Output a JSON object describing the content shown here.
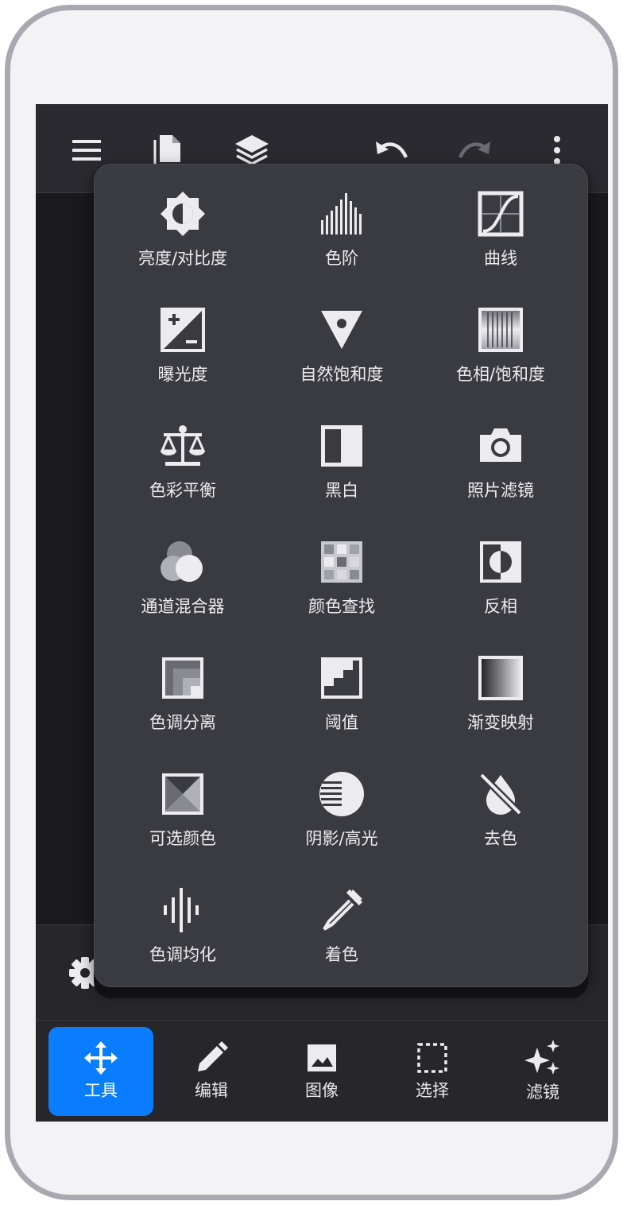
{
  "top_bar": {
    "icons": [
      "menu-icon",
      "documents-icon",
      "layers-icon",
      "undo-icon",
      "redo-icon",
      "more-vertical-icon"
    ]
  },
  "adjustments_menu": {
    "items": [
      {
        "label": "亮度/对比度",
        "icon": "brightness-contrast-icon"
      },
      {
        "label": "色阶",
        "icon": "levels-icon"
      },
      {
        "label": "曲线",
        "icon": "curves-icon"
      },
      {
        "label": "曝光度",
        "icon": "exposure-icon"
      },
      {
        "label": "自然饱和度",
        "icon": "vibrance-icon"
      },
      {
        "label": "色相/饱和度",
        "icon": "hue-saturation-icon"
      },
      {
        "label": "色彩平衡",
        "icon": "color-balance-icon"
      },
      {
        "label": "黑白",
        "icon": "black-white-icon"
      },
      {
        "label": "照片滤镜",
        "icon": "photo-filter-icon"
      },
      {
        "label": "通道混合器",
        "icon": "channel-mixer-icon"
      },
      {
        "label": "颜色查找",
        "icon": "color-lookup-icon"
      },
      {
        "label": "反相",
        "icon": "invert-icon"
      },
      {
        "label": "色调分离",
        "icon": "posterize-icon"
      },
      {
        "label": "阈值",
        "icon": "threshold-icon"
      },
      {
        "label": "渐变映射",
        "icon": "gradient-map-icon"
      },
      {
        "label": "可选颜色",
        "icon": "selective-color-icon"
      },
      {
        "label": "阴影/高光",
        "icon": "shadows-highlights-icon"
      },
      {
        "label": "去色",
        "icon": "desaturate-icon"
      },
      {
        "label": "色调均化",
        "icon": "equalize-icon"
      },
      {
        "label": "着色",
        "icon": "colorize-icon"
      }
    ]
  },
  "bottom_nav": {
    "items": [
      {
        "label": "工具",
        "icon": "move-icon",
        "active": true
      },
      {
        "label": "编辑",
        "icon": "pencil-icon",
        "active": false
      },
      {
        "label": "图像",
        "icon": "image-icon",
        "active": false
      },
      {
        "label": "选择",
        "icon": "selection-icon",
        "active": false
      },
      {
        "label": "滤镜",
        "icon": "sparkles-icon",
        "active": false
      }
    ]
  },
  "colors": {
    "accent": "#0a7cff",
    "menu_bg": "#3a3a41",
    "screen_bg": "#1c1c21",
    "icon": "#ececf0"
  }
}
